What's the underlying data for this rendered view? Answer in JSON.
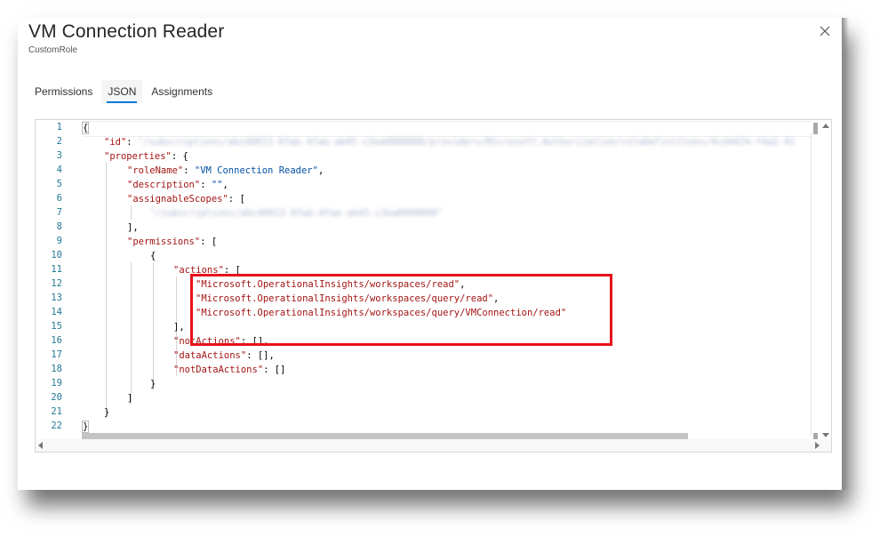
{
  "dialog": {
    "title": "VM Connection Reader",
    "subtitle": "CustomRole",
    "close_icon": "close-icon"
  },
  "tabs": [
    {
      "label": "Permissions",
      "active": false
    },
    {
      "label": "JSON",
      "active": true
    },
    {
      "label": "Assignments",
      "active": false
    }
  ],
  "editor": {
    "line_numbers": [
      "1",
      "2",
      "3",
      "4",
      "5",
      "6",
      "7",
      "8",
      "9",
      "10",
      "11",
      "12",
      "13",
      "14",
      "15",
      "16",
      "17",
      "18",
      "19",
      "20",
      "21",
      "22"
    ],
    "lines": {
      "l1": "{",
      "l2_key": "\"id\"",
      "l2_sep": ": ",
      "l2_val": "\"/subscriptions/abcd0013-0fab-4fae-ab45-c3ea0000000/providers/Microsoft.Authorization/roleDefinitions/4cd4424-f4a2-41",
      "l3_key": "\"properties\"",
      "l3_sep": ": {",
      "l4_key": "\"roleName\"",
      "l4_sep": ": ",
      "l4_val": "\"VM Connection Reader\"",
      "l4_end": ",",
      "l5_key": "\"description\"",
      "l5_sep": ": ",
      "l5_val": "\"\"",
      "l5_end": ",",
      "l6_key": "\"assignableScopes\"",
      "l6_sep": ": [",
      "l7_val": "\"/subscriptions/abcd0013-0fab-4fae-ab45-c3ea0000000\"",
      "l8": "],",
      "l9_key": "\"permissions\"",
      "l9_sep": ": [",
      "l10": "{",
      "l11_key": "\"actions\"",
      "l11_sep": ": [",
      "l12_val": "\"Microsoft.OperationalInsights/workspaces/read\"",
      "l12_end": ",",
      "l13_val": "\"Microsoft.OperationalInsights/workspaces/query/read\"",
      "l13_end": ",",
      "l14_val": "\"Microsoft.OperationalInsights/workspaces/query/VMConnection/read\"",
      "l15": "],",
      "l16_key": "\"notActions\"",
      "l16_sep": ": [],",
      "l17_key": "\"dataActions\"",
      "l17_sep": ": [],",
      "l18_key": "\"notDataActions\"",
      "l18_sep": ": []",
      "l19": "}",
      "l20": "]",
      "l21": "}",
      "l22": "}"
    },
    "highlight_color": "#e8111b"
  }
}
